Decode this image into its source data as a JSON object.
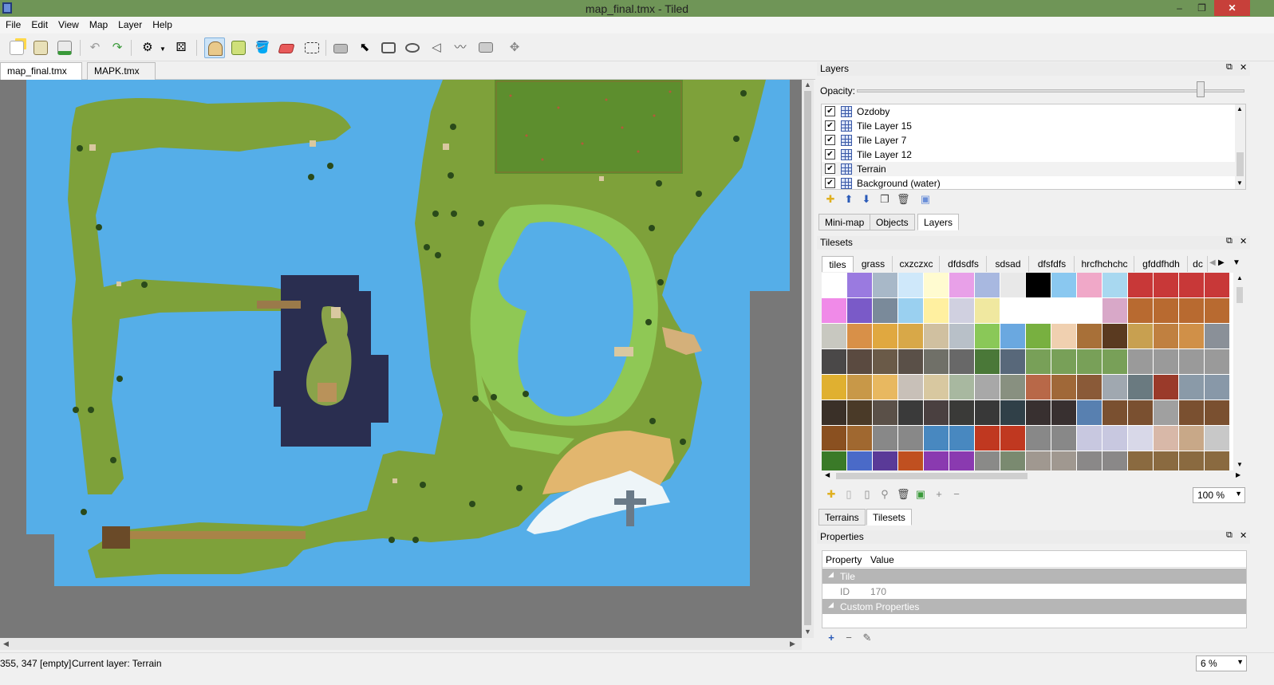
{
  "window": {
    "title": "map_final.tmx - Tiled",
    "controls": [
      "–",
      "❐",
      "✕"
    ]
  },
  "menu": [
    "File",
    "Edit",
    "View",
    "Map",
    "Layer",
    "Help"
  ],
  "toolbar": {
    "buttons": [
      "new-file",
      "open-file",
      "save-file",
      "undo",
      "redo",
      "commands",
      "random-mode",
      "stamp-brush",
      "terrain-brush",
      "bucket-fill",
      "eraser",
      "rectangular-select",
      "magic-wand",
      "select-objects",
      "insert-rectangle",
      "insert-ellipse",
      "insert-polygon",
      "insert-polyline",
      "insert-tile",
      "edit-polygons"
    ]
  },
  "document_tabs": [
    {
      "label": "map_final.tmx",
      "active": true
    },
    {
      "label": "MAPK.tmx",
      "active": false
    }
  ],
  "layers_panel": {
    "title": "Layers",
    "opacity_label": "Opacity:",
    "opacity": 1.0,
    "layers": [
      {
        "name": "Ozdoby",
        "visible": true,
        "selected": false
      },
      {
        "name": "Tile Layer 15",
        "visible": true,
        "selected": false
      },
      {
        "name": "Tile Layer 7",
        "visible": true,
        "selected": false
      },
      {
        "name": "Tile Layer 12",
        "visible": true,
        "selected": false
      },
      {
        "name": "Terrain",
        "visible": true,
        "selected": true
      },
      {
        "name": "Background (water)",
        "visible": true,
        "selected": false
      }
    ],
    "tabs": [
      "Mini-map",
      "Objects",
      "Layers"
    ],
    "active_tab": "Layers"
  },
  "tilesets_panel": {
    "title": "Tilesets",
    "tabs": [
      "tiles",
      "grass",
      "cxzczxc",
      "dfdsdfs",
      "sdsad",
      "dfsfdfs",
      "hrcfhchchc",
      "gfddfhdh",
      "dc"
    ],
    "active_tab": "tiles",
    "zoom": "100 %",
    "tabs_bottom": [
      "Terrains",
      "Tilesets"
    ],
    "active_bottom_tab": "Tilesets"
  },
  "properties_panel": {
    "title": "Properties",
    "headers": [
      "Property",
      "Value"
    ],
    "group_tile": "Tile",
    "id_label": "ID",
    "id_value": "170",
    "group_custom": "Custom Properties"
  },
  "status": {
    "coords": "355, 347 [empty]",
    "current_layer": "Current layer: Terrain",
    "zoom": "6 %"
  },
  "colors": {
    "titlebar": "#6f9557",
    "water": "#55aee8",
    "grass": "#7ea13a",
    "light_grass": "#8fc855",
    "sand": "#e2b66e",
    "snow": "#eef5f8",
    "dark_island": "#2a2e50",
    "canvas_bg": "#787878"
  }
}
